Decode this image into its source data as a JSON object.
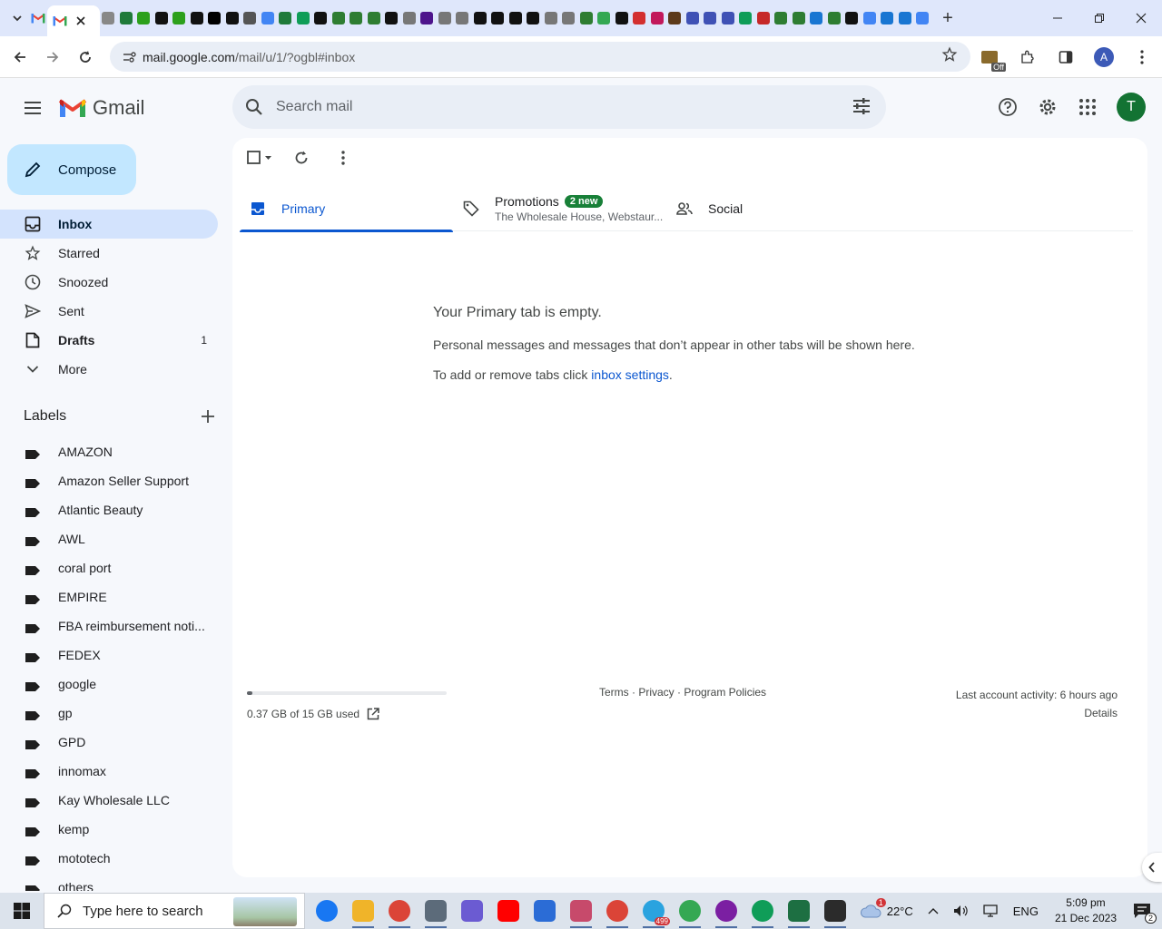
{
  "browser": {
    "url_host": "mail.google.com",
    "url_path": "/mail/u/1/?ogbl#inbox",
    "extension_badge": "Off"
  },
  "gmail": {
    "product_name": "Gmail",
    "search_placeholder": "Search mail",
    "avatar_letter": "T",
    "compose_label": "Compose",
    "nav": [
      {
        "label": "Inbox",
        "icon": "inbox-icon",
        "active": true,
        "bold": true,
        "count": ""
      },
      {
        "label": "Starred",
        "icon": "star-icon",
        "count": ""
      },
      {
        "label": "Snoozed",
        "icon": "clock-icon",
        "count": ""
      },
      {
        "label": "Sent",
        "icon": "send-icon",
        "count": ""
      },
      {
        "label": "Drafts",
        "icon": "draft-icon",
        "bold": true,
        "count": "1"
      },
      {
        "label": "More",
        "icon": "chevron-down-icon",
        "count": ""
      }
    ],
    "labels_title": "Labels",
    "labels": [
      "AMAZON",
      "Amazon Seller Support",
      "Atlantic Beauty",
      "AWL",
      "coral port",
      "EMPIRE",
      "FBA reimbursement noti...",
      "FEDEX",
      "google",
      "gp",
      "GPD",
      "innomax",
      "Kay Wholesale LLC",
      "kemp",
      "mototech",
      "others"
    ],
    "tabs": {
      "primary": "Primary",
      "promotions": "Promotions",
      "promotions_badge": "2 new",
      "promotions_senders": "The Wholesale House, Webstaur...",
      "social": "Social"
    },
    "empty": {
      "title": "Your Primary tab is empty.",
      "line1": "Personal messages and messages that don’t appear in other tabs will be shown here.",
      "line2_prefix": "To add or remove tabs click ",
      "line2_link": "inbox settings",
      "line2_suffix": "."
    },
    "footer": {
      "storage_used": "0.37 GB of 15 GB used",
      "storage_fraction": 0.025,
      "links": "Terms · Privacy · Program Policies",
      "activity": "Last account activity: 6 hours ago",
      "details": "Details"
    }
  },
  "taskbar": {
    "search_placeholder": "Type here to search",
    "weather": "22°C",
    "weather_badge": "1",
    "language": "ENG",
    "time": "5:09 pm",
    "date": "21 Dec 2023",
    "notification_count": "2",
    "telegram_badge": "499"
  },
  "colors": {
    "accent": "#0b57d0",
    "compose_bg": "#c2e7ff",
    "active_nav": "#d3e3fd",
    "badge_green": "#188038"
  }
}
